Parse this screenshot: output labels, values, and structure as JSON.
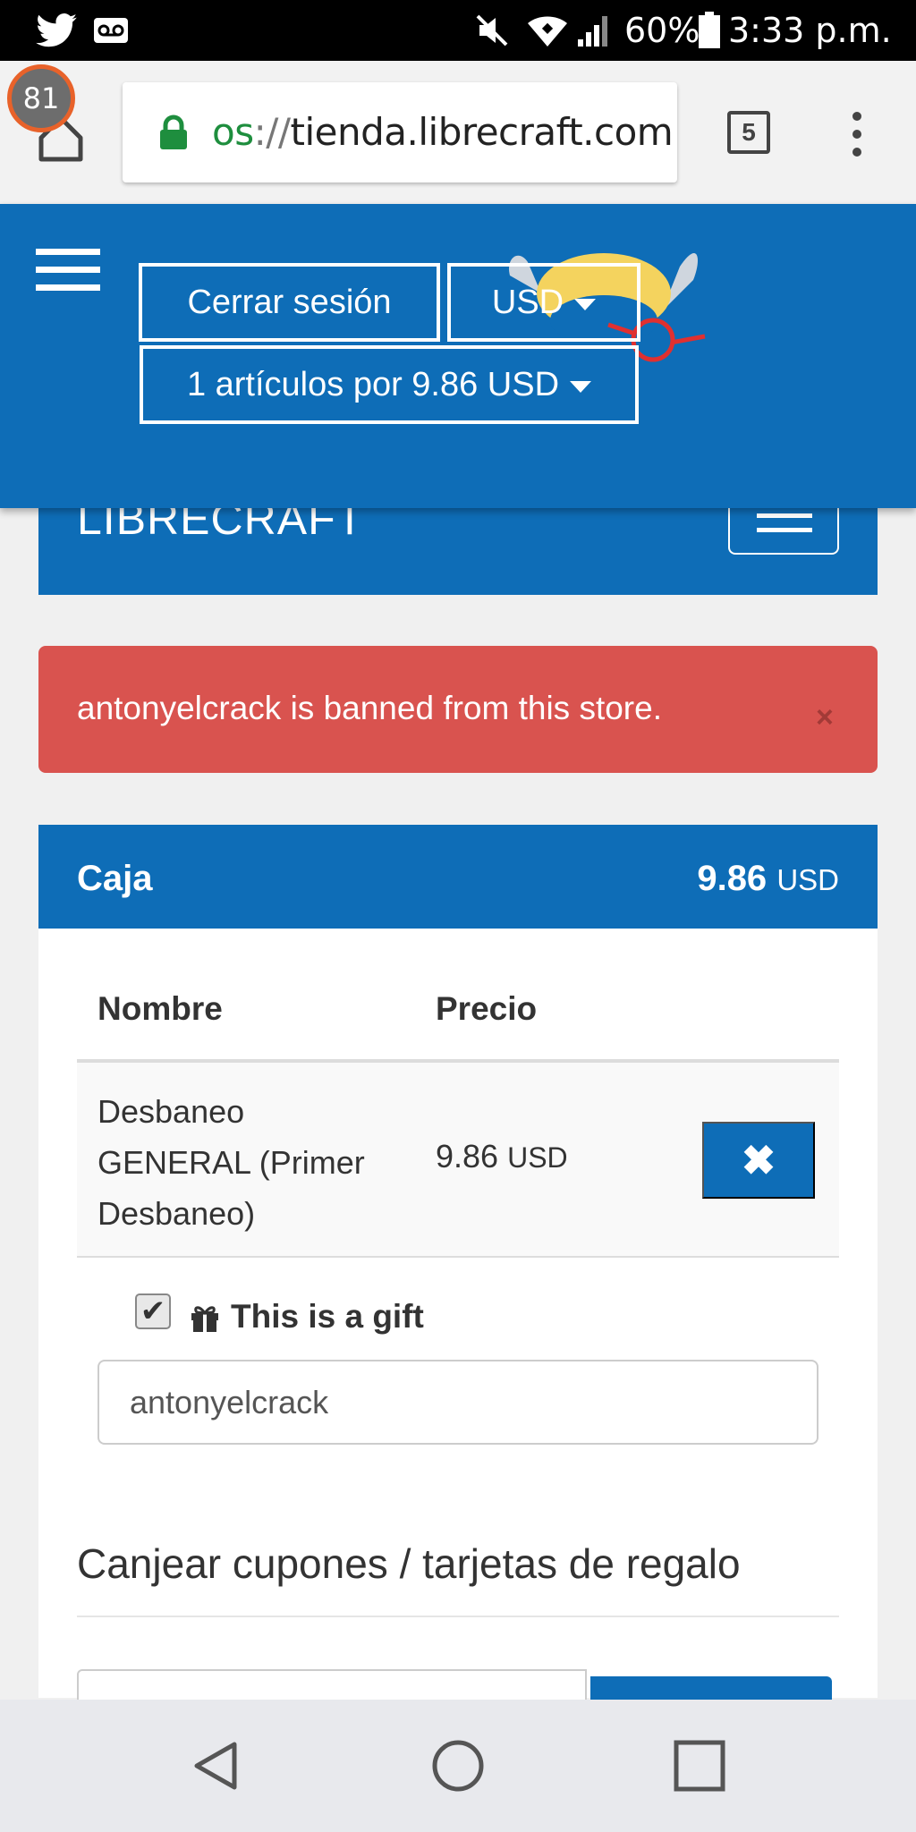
{
  "status_bar": {
    "battery": "60%",
    "time": "3:33 p.m.",
    "icons": [
      "twitter-icon",
      "voicemail-icon",
      "mute-icon",
      "wifi-icon",
      "signal-icon",
      "battery-icon"
    ]
  },
  "browser": {
    "tab_badge": "81",
    "url_scheme": "os",
    "url_sep": "://",
    "url_host": "tienda.librecraft.com",
    "tabs_count": "5"
  },
  "header": {
    "logout": "Cerrar sesión",
    "currency": "USD",
    "cart_summary": "1 artículos por 9.86 USD"
  },
  "brand": "LIBRECRAFT",
  "alert": {
    "message": "antonyelcrack is banned from this store.",
    "close": "×"
  },
  "checkout": {
    "title": "Caja",
    "total_amount": "9.86",
    "total_currency": "USD",
    "columns": [
      "Nombre",
      "Precio"
    ],
    "items": [
      {
        "name": "Desbaneo GENERAL (Primer Desbaneo)",
        "price": "9.86",
        "currency": "USD"
      }
    ],
    "remove_glyph": "✖",
    "gift_label": "This is a gift",
    "gift_checked": true,
    "gift_username": "antonyelcrack"
  },
  "coupons": {
    "title": "Canjear cupones / tarjetas de regalo"
  },
  "colors": {
    "primary": "#0e6db7",
    "alert": "#d9534f",
    "url_secure": "#1e8e3e"
  }
}
